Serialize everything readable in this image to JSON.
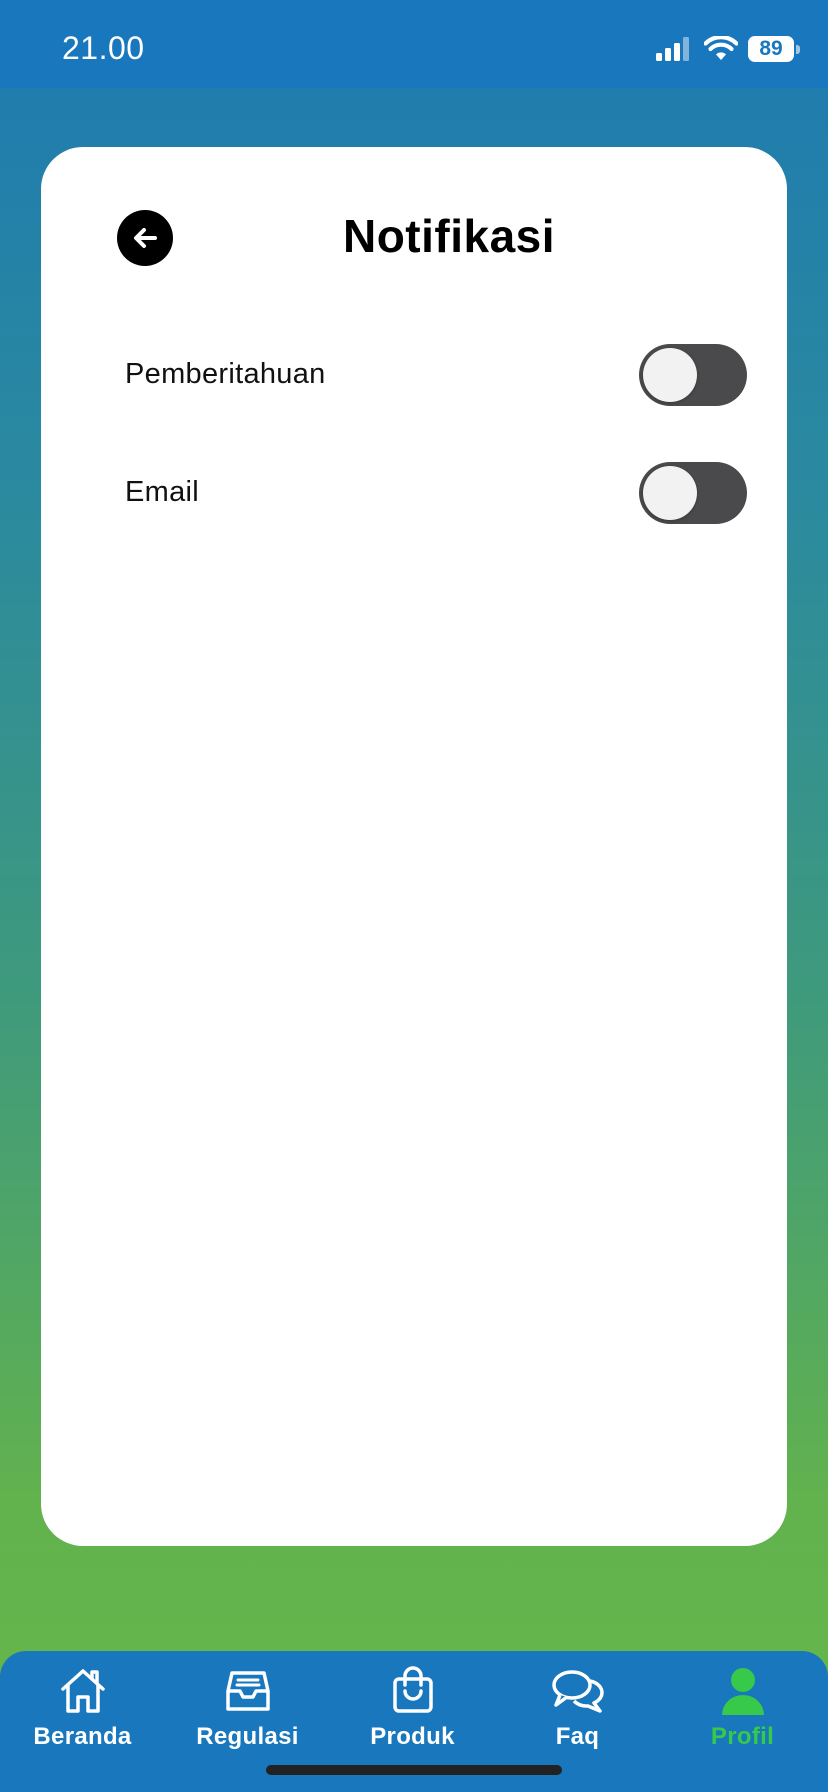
{
  "status_bar": {
    "time": "21.00",
    "battery": "89",
    "signal_icon": "cellular-signal-icon",
    "wifi_icon": "wifi-icon"
  },
  "header": {
    "title": "Notifikasi",
    "back_icon": "arrow-left-icon"
  },
  "settings": [
    {
      "label": "Pemberitahuan",
      "enabled": false
    },
    {
      "label": "Email",
      "enabled": false
    }
  ],
  "tab_bar": {
    "tabs": [
      {
        "label": "Beranda",
        "icon": "home-icon",
        "active": false
      },
      {
        "label": "Regulasi",
        "icon": "inbox-icon",
        "active": false
      },
      {
        "label": "Produk",
        "icon": "shopping-bag-icon",
        "active": false
      },
      {
        "label": "Faq",
        "icon": "chat-bubbles-icon",
        "active": false
      },
      {
        "label": "Profil",
        "icon": "user-icon",
        "active": true
      }
    ]
  },
  "colors": {
    "primary": "#1877bd",
    "active_tab": "#36c94a",
    "toggle_off": "#4a4a4c",
    "card": "#ffffff"
  }
}
